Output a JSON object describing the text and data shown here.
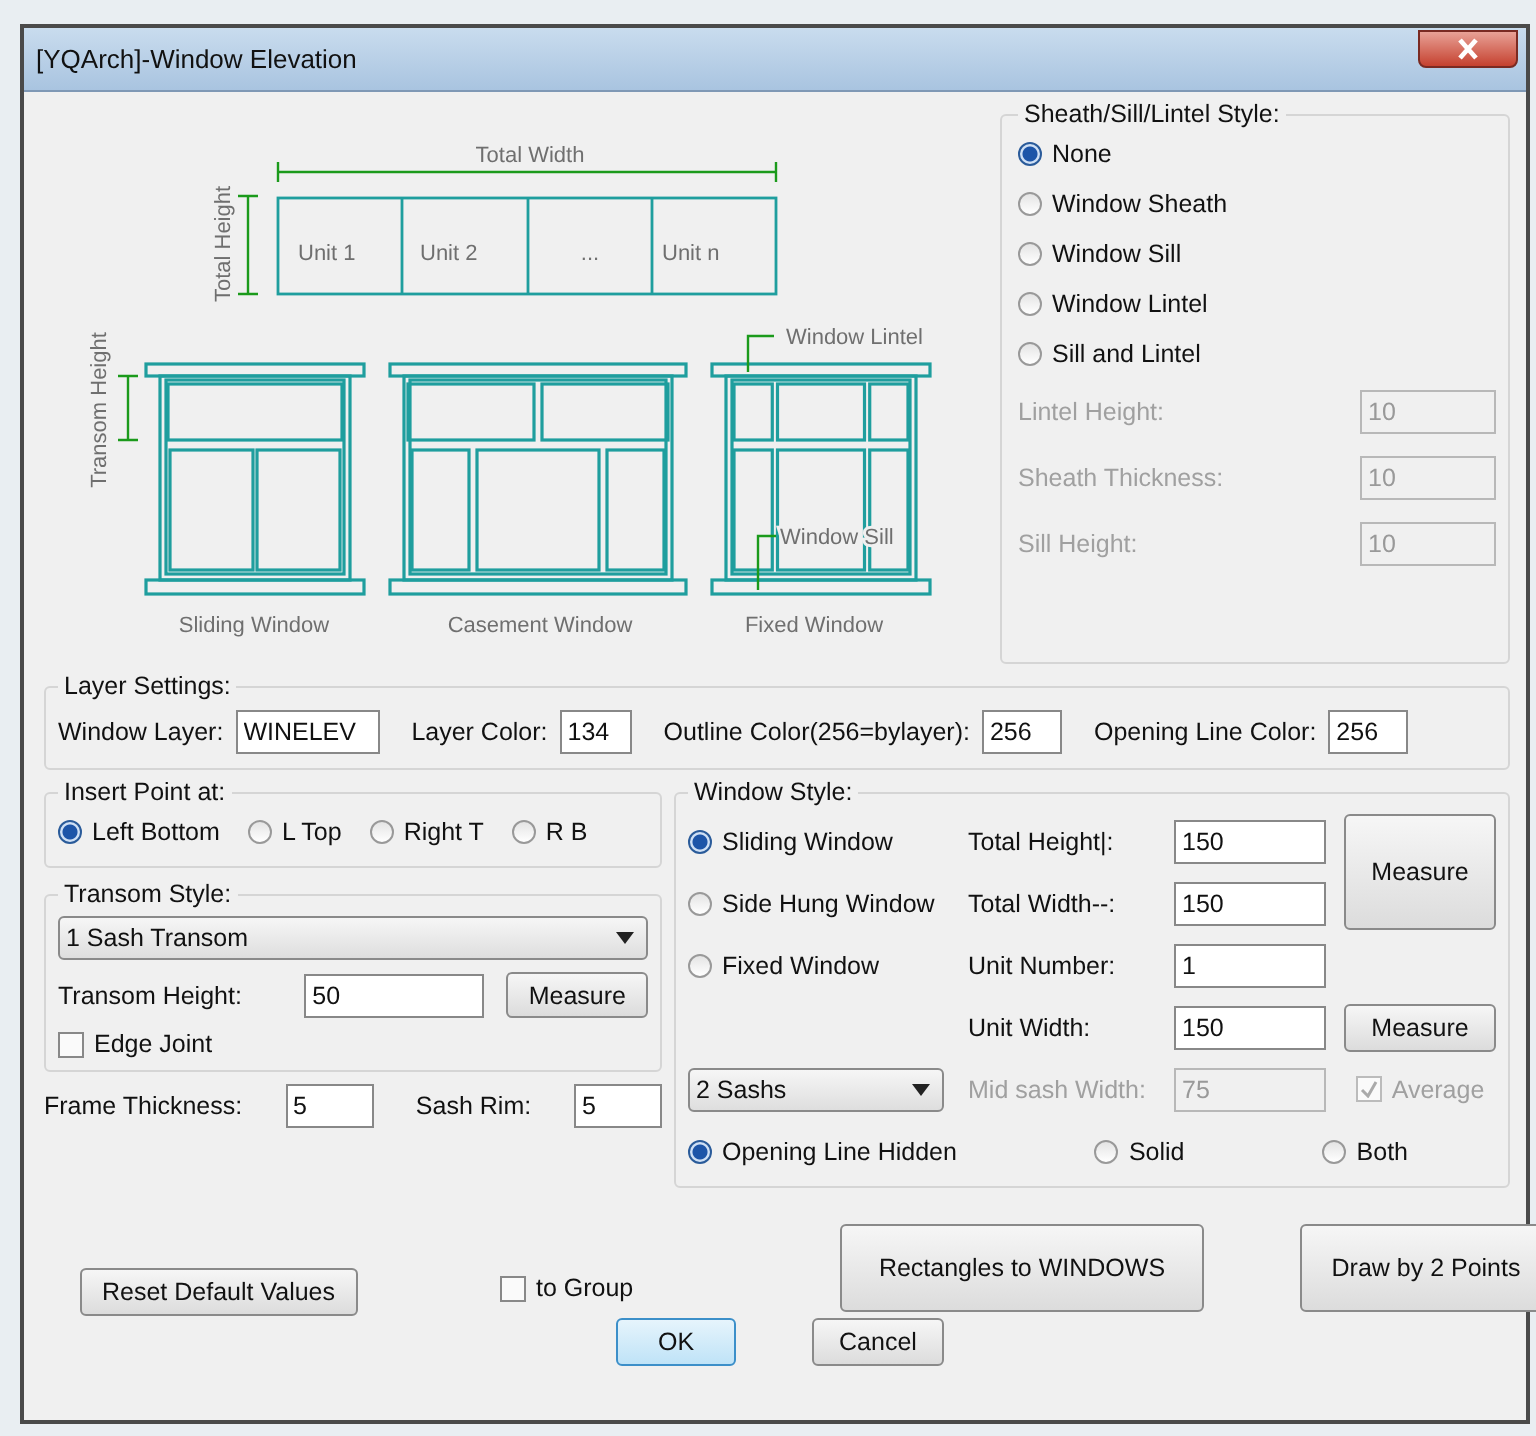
{
  "window": {
    "title": "[YQArch]-Window Elevation"
  },
  "diagram": {
    "total_width": "Total Width",
    "total_height": "Total Height",
    "units": [
      "Unit 1",
      "Unit 2",
      "...",
      "Unit n"
    ],
    "transom_height": "Transom Height",
    "window_lintel": "Window Lintel",
    "window_sill": "Window Sill",
    "captions": [
      "Sliding Window",
      "Casement Window",
      "Fixed Window"
    ]
  },
  "sheath_style": {
    "title": "Sheath/Sill/Lintel Style:",
    "options": [
      {
        "label": "None",
        "selected": true
      },
      {
        "label": "Window Sheath",
        "selected": false
      },
      {
        "label": "Window Sill",
        "selected": false
      },
      {
        "label": "Window Lintel",
        "selected": false
      },
      {
        "label": "Sill and Lintel",
        "selected": false
      }
    ],
    "fields": [
      {
        "label": "Lintel Height:",
        "value": "10",
        "disabled": true
      },
      {
        "label": "Sheath Thickness:",
        "value": "10",
        "disabled": true
      },
      {
        "label": "Sill Height:",
        "value": "10",
        "disabled": true
      }
    ]
  },
  "layer_settings": {
    "title": "Layer Settings:",
    "fields": [
      {
        "label": "Window Layer:",
        "value": "WINELEV"
      },
      {
        "label": "Layer Color:",
        "value": "134"
      },
      {
        "label": "Outline Color(256=bylayer):",
        "value": "256"
      },
      {
        "label": "Opening Line Color:",
        "value": "256"
      }
    ]
  },
  "insert_point": {
    "title": "Insert Point at:",
    "options": [
      {
        "label": "Left Bottom",
        "selected": true
      },
      {
        "label": "L Top",
        "selected": false
      },
      {
        "label": "Right T",
        "selected": false
      },
      {
        "label": "R B",
        "selected": false
      }
    ]
  },
  "transom_style": {
    "title": "Transom Style:",
    "dropdown": "1 Sash Transom",
    "height": {
      "label": "Transom Height:",
      "value": "50"
    },
    "measure": "Measure",
    "edge_joint": {
      "label": "Edge Joint",
      "checked": false
    }
  },
  "frame": [
    {
      "label": "Frame Thickness:",
      "value": "5"
    },
    {
      "label": "Sash Rim:",
      "value": "5"
    }
  ],
  "window_style": {
    "title": "Window Style:",
    "types": [
      {
        "label": "Sliding Window",
        "selected": true
      },
      {
        "label": "Side Hung Window",
        "selected": false
      },
      {
        "label": "Fixed Window",
        "selected": false
      }
    ],
    "fields": [
      {
        "label": "Total Height|:",
        "value": "150",
        "disabled": false
      },
      {
        "label": "Total Width--:",
        "value": "150",
        "disabled": false
      },
      {
        "label": "Unit Number:",
        "value": "1",
        "disabled": false
      },
      {
        "label": "Unit Width:",
        "value": "150",
        "disabled": false
      },
      {
        "label": "Mid sash Width:",
        "value": "75",
        "disabled": true
      }
    ],
    "measure_buttons": [
      "Measure",
      "Measure"
    ],
    "sash_dropdown": "2 Sashs",
    "average": {
      "label": "Average",
      "checked": true,
      "disabled": true
    },
    "opening_lines": [
      {
        "label": "Opening Line Hidden",
        "selected": true
      },
      {
        "label": "Solid",
        "selected": false
      },
      {
        "label": "Both",
        "selected": false
      }
    ]
  },
  "buttons": {
    "reset": "Reset Default Values",
    "to_group": {
      "label": "to Group",
      "checked": false
    },
    "rectangles": "Rectangles to WINDOWS",
    "draw": "Draw by 2 Points",
    "ok": "OK",
    "cancel": "Cancel"
  }
}
